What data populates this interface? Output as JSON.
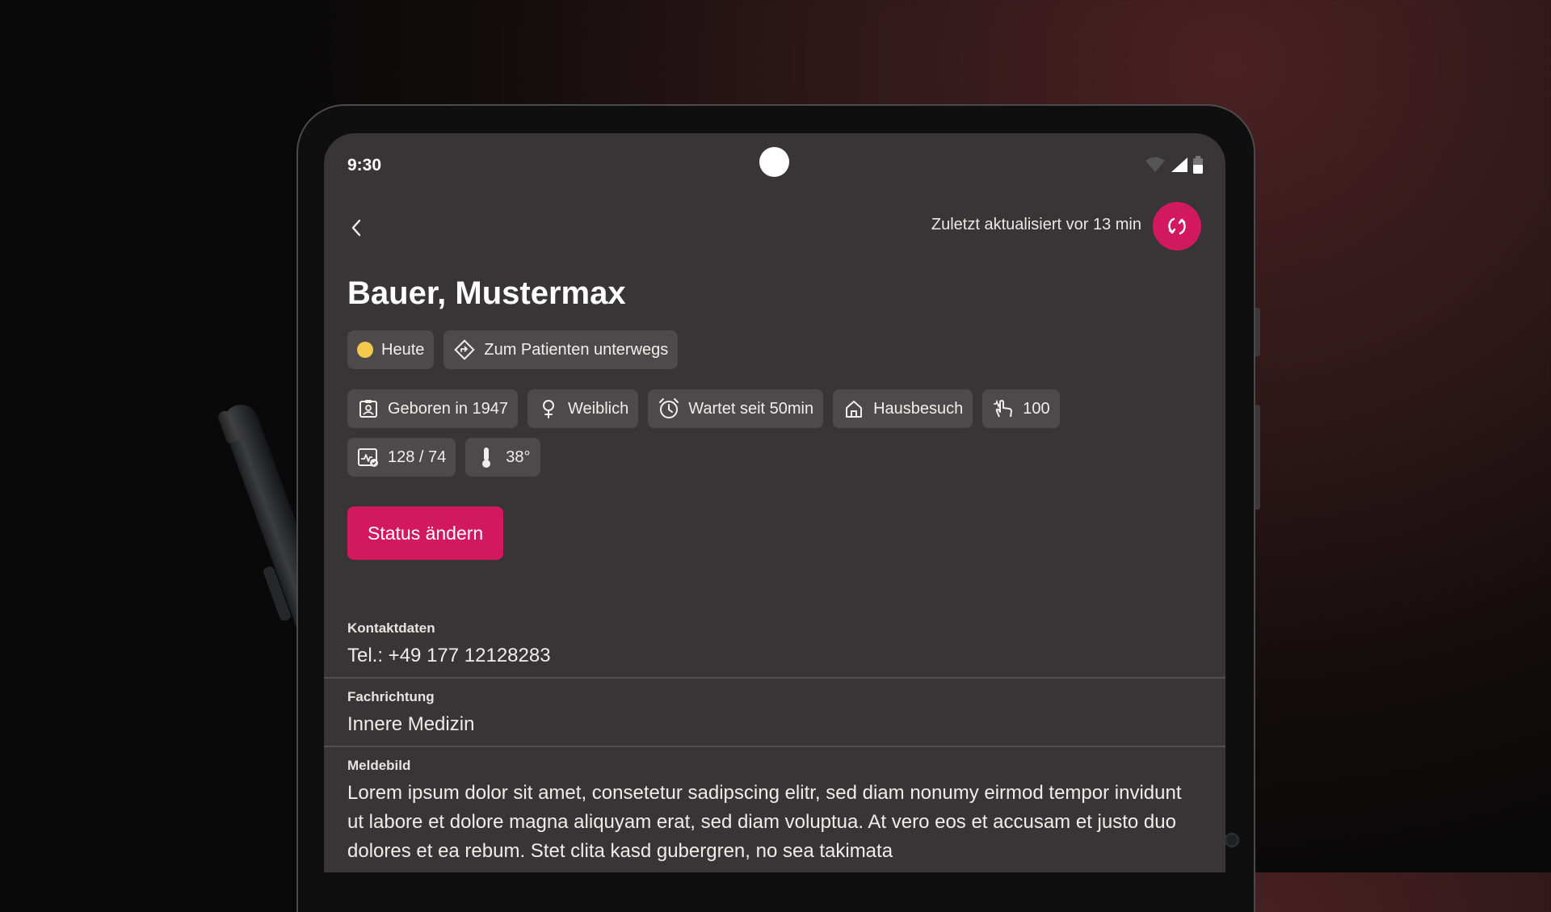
{
  "status_bar": {
    "time": "9:30"
  },
  "top_bar": {
    "updated_text": "Zuletzt aktualisiert vor 13 min"
  },
  "patient": {
    "name": "Bauer, Mustermax",
    "tags": [
      {
        "label": "Heute",
        "icon": "yellow-dot"
      },
      {
        "label": "Zum Patienten unterwegs",
        "icon": "route-icon"
      }
    ],
    "info_chips": [
      {
        "label": "Geboren in 1947",
        "icon": "id-card-icon"
      },
      {
        "label": "Weiblich",
        "icon": "female-icon"
      },
      {
        "label": "Wartet seit 50min",
        "icon": "alarm-clock-icon"
      },
      {
        "label": "Hausbesuch",
        "icon": "home-icon"
      },
      {
        "label": "100",
        "icon": "pulse-hand-icon"
      }
    ],
    "vitals_chips": [
      {
        "label": "128 / 74",
        "icon": "blood-pressure-icon"
      },
      {
        "label": "38°",
        "icon": "thermometer-icon"
      }
    ]
  },
  "actions": {
    "status_button": "Status ändern"
  },
  "details": {
    "contact": {
      "label": "Kontaktdaten",
      "value": "Tel.: +49 177 12128283"
    },
    "specialty": {
      "label": "Fachrichtung",
      "value": "Innere Medizin"
    },
    "report": {
      "label": "Meldebild",
      "value": "Lorem ipsum dolor sit amet, consetetur sadipscing elitr, sed diam nonumy eirmod tempor invidunt ut labore et dolore magna aliquyam erat, sed diam voluptua. At vero eos et accusam et justo duo dolores et ea rebum. Stet clita kasd gubergren, no sea takimata"
    }
  },
  "colors": {
    "accent": "#d2185f",
    "screen_bg": "#393536",
    "chip_bg": "#4e4a4b",
    "today_dot": "#f2c94c"
  }
}
